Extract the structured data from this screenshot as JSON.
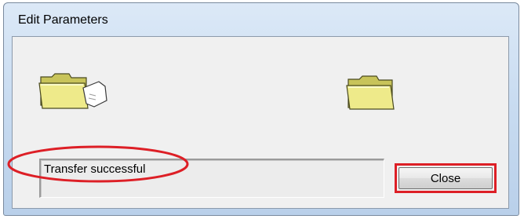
{
  "window": {
    "title": "Edit Parameters"
  },
  "status": {
    "text": "Transfer successful"
  },
  "buttons": {
    "close_label": "Close"
  },
  "icons": {
    "source": "folder-with-document-icon",
    "destination": "folder-icon"
  },
  "colors": {
    "folder_fill": "#e8e57a",
    "annotation_red": "#dd1f26",
    "title_gradient_top": "#dce9f7"
  }
}
